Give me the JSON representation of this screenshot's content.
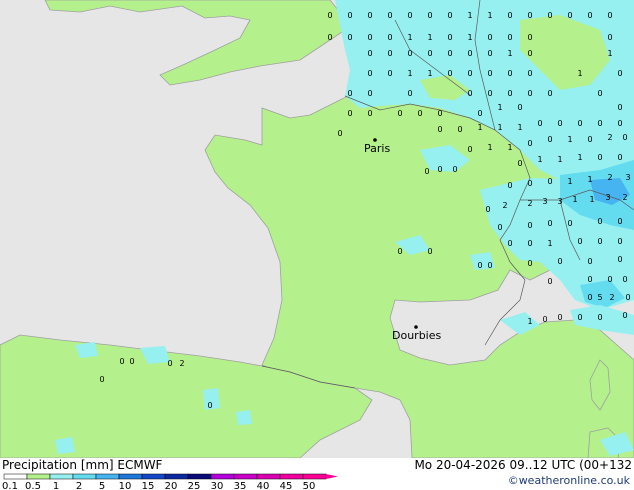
{
  "map": {
    "colors": {
      "sea": "#e6e6e6",
      "land_dry": "#ffffff",
      "precip_light": "#b4f08c",
      "precip_010": "#96f0f0",
      "precip_1": "#64dcf0",
      "precip_2": "#46b4f0",
      "border": "#5a5a5a",
      "coast": "#a0a0a0"
    },
    "cities": [
      {
        "id": "paris",
        "name": "Paris"
      },
      {
        "id": "bourges",
        "name": "Dourbies"
      }
    ],
    "value_glyphs": [
      "0",
      "1",
      "2",
      "5"
    ]
  },
  "footer": {
    "title": "Precipitation [mm]  ECMWF",
    "datetime": "Mo 20-04-2026 09..12 UTC (00+132",
    "credit": "©weatheronline.co.uk",
    "scale_labels": [
      "0.1",
      "0.5",
      "1",
      "2",
      "5",
      "10",
      "15",
      "20",
      "25",
      "30",
      "35",
      "40",
      "45",
      "50"
    ],
    "scale_colors": [
      "#fefefe",
      "#b4f08c",
      "#96f0f0",
      "#64dcf0",
      "#46b4f0",
      "#1e78dc",
      "#1446c8",
      "#0a28a0",
      "#0a0a78",
      "#b400dc",
      "#c800c8",
      "#dc00b4",
      "#f000a0",
      "#ff0096"
    ]
  }
}
